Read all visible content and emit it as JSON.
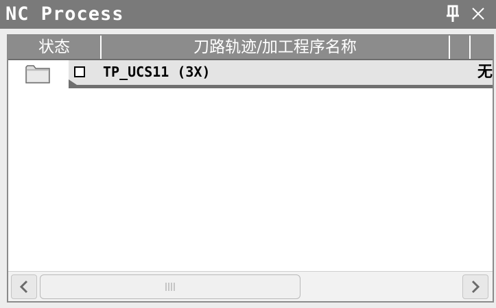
{
  "panel": {
    "title": "NC Process"
  },
  "icons": {
    "pin": "pin-icon",
    "close": "close-icon",
    "folder": "folder-icon",
    "scroll_left": "chevron-left-icon",
    "scroll_right": "chevron-right-icon",
    "grip": "grip-icon"
  },
  "table": {
    "columns": [
      {
        "label": "状态"
      },
      {
        "label": "刀路轨迹/加工程序名称"
      },
      {
        "label": ""
      },
      {
        "label": ""
      }
    ],
    "rows": [
      {
        "name": "TP_UCS11 (3X)",
        "extra": "无"
      }
    ]
  },
  "colors": {
    "titlebar": "#7a7a7a",
    "header": "#8c8c8c",
    "row_highlight": "#e4e4e4"
  }
}
